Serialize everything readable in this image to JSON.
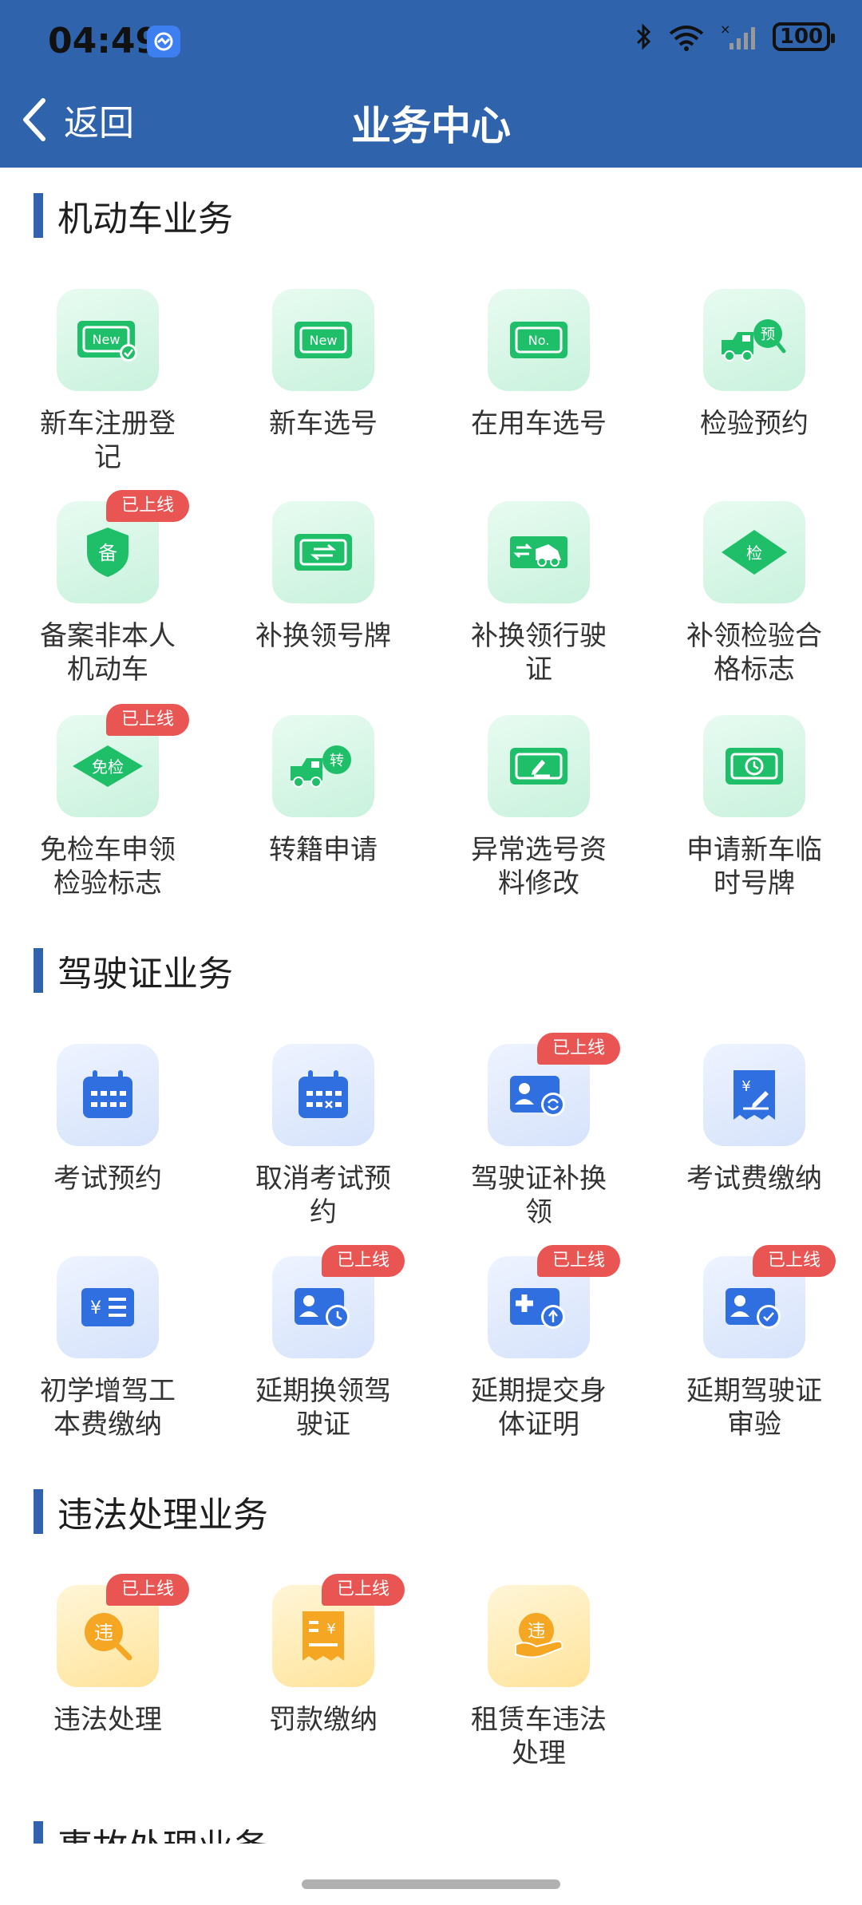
{
  "status_bar": {
    "time": "04:49",
    "battery": "100"
  },
  "header": {
    "back_label": "返回",
    "title": "业务中心"
  },
  "badge_text": "已上线",
  "sections": [
    {
      "title": "机动车业务",
      "items": [
        {
          "label": "新车注册登记",
          "icon": "new-plate-check-icon",
          "online": false
        },
        {
          "label": "新车选号",
          "icon": "new-plate-icon",
          "online": false
        },
        {
          "label": "在用车选号",
          "icon": "no-plate-icon",
          "online": false
        },
        {
          "label": "检验预约",
          "icon": "truck-reserve-icon",
          "online": false
        },
        {
          "label": "备案非本人机动车",
          "icon": "shield-record-icon",
          "online": true
        },
        {
          "label": "补换领号牌",
          "icon": "plate-swap-icon",
          "online": false
        },
        {
          "label": "补换领行驶证",
          "icon": "car-swap-icon",
          "online": false
        },
        {
          "label": "补领检验合格标志",
          "icon": "inspection-diamond-icon",
          "online": false
        },
        {
          "label": "免检车申领检验标志",
          "icon": "exempt-diamond-icon",
          "online": true
        },
        {
          "label": "转籍申请",
          "icon": "truck-transfer-icon",
          "online": false
        },
        {
          "label": "异常选号资料修改",
          "icon": "plate-edit-icon",
          "online": false
        },
        {
          "label": "申请新车临时号牌",
          "icon": "plate-clock-icon",
          "online": false
        }
      ]
    },
    {
      "title": "驾驶证业务",
      "items": [
        {
          "label": "考试预约",
          "icon": "calendar-icon",
          "online": false
        },
        {
          "label": "取消考试预约",
          "icon": "calendar-cancel-icon",
          "online": false
        },
        {
          "label": "驾驶证补换领",
          "icon": "license-swap-icon",
          "online": true
        },
        {
          "label": "考试费缴纳",
          "icon": "fee-receipt-icon",
          "online": false
        },
        {
          "label": "初学增驾工本费缴纳",
          "icon": "fee-list-icon",
          "online": false
        },
        {
          "label": "延期换领驾驶证",
          "icon": "license-clock-icon",
          "online": true
        },
        {
          "label": "延期提交身体证明",
          "icon": "medical-upload-icon",
          "online": true
        },
        {
          "label": "延期驾驶证审验",
          "icon": "license-check-icon",
          "online": true
        }
      ]
    },
    {
      "title": "违法处理业务",
      "items": [
        {
          "label": "违法处理",
          "icon": "violation-search-icon",
          "online": true
        },
        {
          "label": "罚款缴纳",
          "icon": "fine-receipt-icon",
          "online": true
        },
        {
          "label": "租赁车违法处理",
          "icon": "rental-violation-icon",
          "online": false
        }
      ]
    },
    {
      "title": "事故处理业务",
      "items": []
    }
  ],
  "colors": {
    "header": "#2f64ad",
    "green": "#1fbf6a",
    "blue": "#2f6fe0",
    "orange": "#f5a623",
    "badge": "#e85552"
  }
}
